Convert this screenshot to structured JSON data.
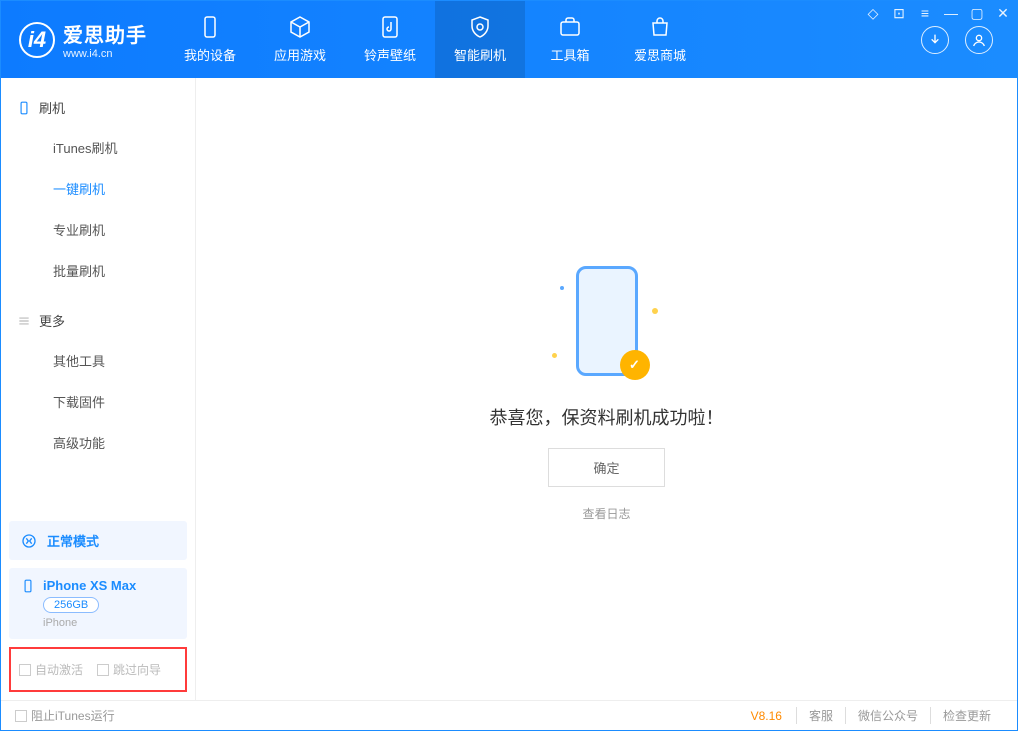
{
  "app": {
    "name_cn": "爱思助手",
    "name_en": "www.i4.cn"
  },
  "tabs": [
    {
      "label": "我的设备"
    },
    {
      "label": "应用游戏"
    },
    {
      "label": "铃声壁纸"
    },
    {
      "label": "智能刷机"
    },
    {
      "label": "工具箱"
    },
    {
      "label": "爱思商城"
    }
  ],
  "sidebar": {
    "sec1_title": "刷机",
    "sec1_items": [
      "iTunes刷机",
      "一键刷机",
      "专业刷机",
      "批量刷机"
    ],
    "sec2_title": "更多",
    "sec2_items": [
      "其他工具",
      "下载固件",
      "高级功能"
    ]
  },
  "mode": {
    "label": "正常模式"
  },
  "device": {
    "name": "iPhone XS Max",
    "storage": "256GB",
    "type": "iPhone"
  },
  "options": {
    "auto_activate": "自动激活",
    "skip_guide": "跳过向导"
  },
  "result": {
    "message": "恭喜您，保资料刷机成功啦！",
    "ok": "确定",
    "view_log": "查看日志"
  },
  "footer": {
    "block_itunes": "阻止iTunes运行",
    "version": "V8.16",
    "links": [
      "客服",
      "微信公众号",
      "检查更新"
    ]
  }
}
